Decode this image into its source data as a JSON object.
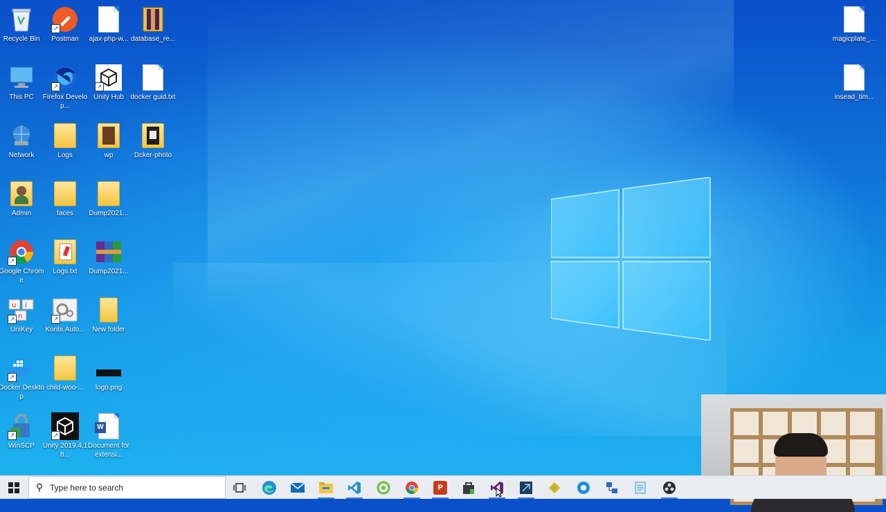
{
  "desktop": {
    "icons": [
      {
        "label": "Recycle Bin"
      },
      {
        "label": "Postman"
      },
      {
        "label": "ajax-php-w..."
      },
      {
        "label": "database_re..."
      },
      {
        "label": "This PC"
      },
      {
        "label": "Firefox Develop..."
      },
      {
        "label": "Unity Hub"
      },
      {
        "label": "docker guid.txt"
      },
      {
        "label": "Network"
      },
      {
        "label": "Logs"
      },
      {
        "label": "wp"
      },
      {
        "label": "Dcker-photo"
      },
      {
        "label": "Admin"
      },
      {
        "label": "faces"
      },
      {
        "label": "Dump2021..."
      },
      {
        "label": "Google Chrome"
      },
      {
        "label": "Logs.txt"
      },
      {
        "label": "Dump2021..."
      },
      {
        "label": "UniKey"
      },
      {
        "label": "Konbi.Auto..."
      },
      {
        "label": "New folder"
      },
      {
        "label": "Docker Desktop"
      },
      {
        "label": "child-woo-..."
      },
      {
        "label": "logo.png"
      },
      {
        "label": "WinSCP"
      },
      {
        "label": "Unity 2019.4.18..."
      },
      {
        "label": "Document for extensi..."
      },
      {
        "label": "magicplate_..."
      },
      {
        "label": "insead_tim..."
      }
    ]
  },
  "taskbar": {
    "search_placeholder": "Type here to search",
    "icons": [
      "task-view-icon",
      "edge-icon",
      "mail-icon",
      "file-explorer-icon",
      "vscode-icon",
      "greenshot-icon",
      "chrome-icon",
      "powerpoint-icon",
      "store-icon",
      "visual-studio-icon",
      "azure-data-studio-icon",
      "app-icon",
      "sourcetree-icon",
      "network-icon",
      "notepad-icon",
      "obs-icon"
    ]
  },
  "colors": {
    "accent": "#1a75d8",
    "taskbar": "#e9edf2"
  }
}
